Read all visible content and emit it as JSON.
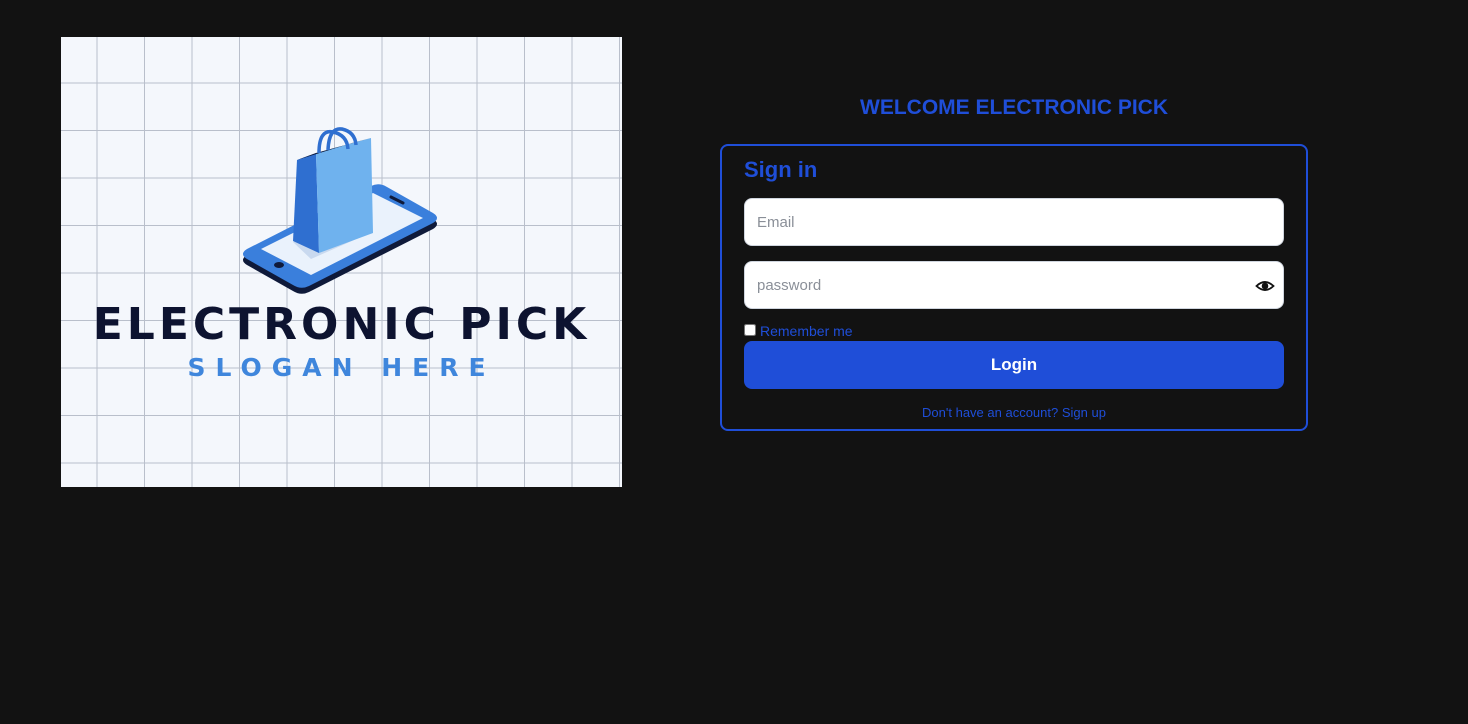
{
  "logo": {
    "brand_name": "ELECTRONIC PICK",
    "slogan": "SLOGAN HERE"
  },
  "welcome": {
    "title": "WELCOME ELECTRONIC PICK"
  },
  "signin": {
    "heading": "Sign in",
    "email_placeholder": "Email",
    "email_value": "",
    "password_placeholder": "password",
    "password_value": "",
    "remember_label": "Remember me",
    "remember_checked": false,
    "login_label": "Login",
    "signup_prompt": "Don't have an account?",
    "signup_link": "Sign up"
  },
  "icons": {
    "password_toggle": "eye-icon",
    "logo": "shopping-bag-on-phone-icon"
  },
  "colors": {
    "background": "#121212",
    "accent": "#1f4ed8",
    "logo_background": "#f4f7fc",
    "brand_text": "#0d1330",
    "slogan_text": "#3f86dc"
  }
}
